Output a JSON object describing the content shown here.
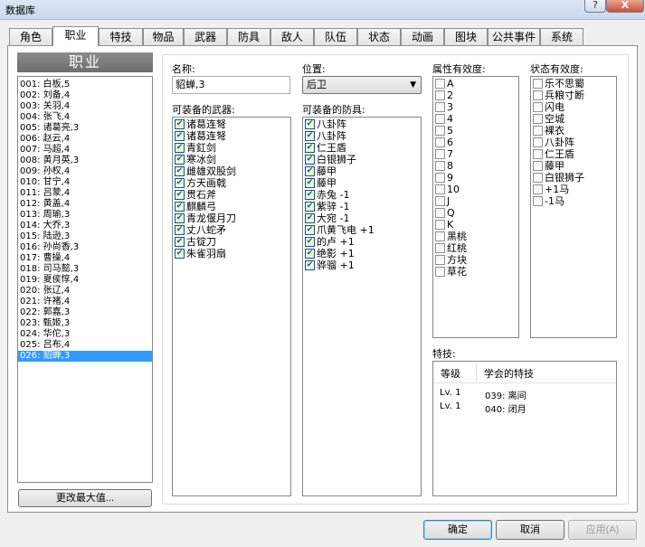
{
  "window": {
    "title": "数据库",
    "help_label": "?",
    "close_label": "X"
  },
  "tabs": [
    "角色",
    "职业",
    "特技",
    "物品",
    "武器",
    "防具",
    "敌人",
    "队伍",
    "状态",
    "动画",
    "图块",
    "公共事件",
    "系统"
  ],
  "active_tab": 1,
  "class_panel": {
    "header": "职业",
    "items": [
      "001: 白板,5",
      "002: 刘备,4",
      "003: 关羽,4",
      "004: 张飞,4",
      "005: 诸葛亮,3",
      "006: 赵云,4",
      "007: 马超,4",
      "008: 黄月英,3",
      "009: 孙权,4",
      "010: 甘宁,4",
      "011: 吕蒙,4",
      "012: 黄盖,4",
      "013: 周瑜,3",
      "014: 大乔,3",
      "015: 陆逊,3",
      "016: 孙尚香,3",
      "017: 曹操,4",
      "018: 司马懿,3",
      "019: 夏侯惇,4",
      "020: 张辽,4",
      "021: 许褚,4",
      "022: 郭嘉,3",
      "023: 甄姬,3",
      "024: 华佗,3",
      "025: 吕布,4",
      "026: 貂蝉,3"
    ],
    "selected_index": 25,
    "change_max_label": "更改最大值..."
  },
  "form": {
    "name_label": "名称:",
    "name_value": "貂蝉,3",
    "position_label": "位置:",
    "position_value": "后卫",
    "weapons_label": "可装备的武器:",
    "weapons": [
      {
        "text": "诸葛连弩",
        "checked": true
      },
      {
        "text": "诸葛连弩",
        "checked": true
      },
      {
        "text": "青釭剑",
        "checked": true
      },
      {
        "text": "寒冰剑",
        "checked": true
      },
      {
        "text": "雌雄双股剑",
        "checked": true
      },
      {
        "text": "方天画戟",
        "checked": true
      },
      {
        "text": "贯石斧",
        "checked": true
      },
      {
        "text": "麒麟弓",
        "checked": true
      },
      {
        "text": "青龙偃月刀",
        "checked": true
      },
      {
        "text": "丈八蛇矛",
        "checked": true
      },
      {
        "text": "古锭刀",
        "checked": true
      },
      {
        "text": "朱雀羽扇",
        "checked": true
      }
    ],
    "armors_label": "可装备的防具:",
    "armors": [
      {
        "text": "八卦阵",
        "checked": true
      },
      {
        "text": "八卦阵",
        "checked": true
      },
      {
        "text": "仁王盾",
        "checked": true
      },
      {
        "text": "白银狮子",
        "checked": true
      },
      {
        "text": "藤甲",
        "checked": true
      },
      {
        "text": "藤甲",
        "checked": true
      },
      {
        "text": "赤兔 -1",
        "checked": true
      },
      {
        "text": "紫骍 -1",
        "checked": true
      },
      {
        "text": "大宛 -1",
        "checked": true
      },
      {
        "text": "爪黄飞电 +1",
        "checked": true
      },
      {
        "text": "的卢 +1",
        "checked": true
      },
      {
        "text": "绝影 +1",
        "checked": true
      },
      {
        "text": "骅骝 +1",
        "checked": true
      }
    ],
    "element_label": "属性有效度:",
    "elements": [
      "A",
      "2",
      "3",
      "4",
      "5",
      "6",
      "7",
      "8",
      "9",
      "10",
      "J",
      "Q",
      "K",
      "黑桃",
      "红桃",
      "方块",
      "草花"
    ],
    "state_label": "状态有效度:",
    "states": [
      "乐不思蜀",
      "兵粮寸断",
      "闪电",
      "空城",
      "裸衣",
      "八卦阵",
      "仁王盾",
      "藤甲",
      "白银狮子",
      "+1马",
      "-1马"
    ],
    "skills_label": "特技:",
    "skills_headers": [
      "等级",
      "学会的特技"
    ],
    "skills": [
      {
        "level": "Lv. 1",
        "skill": "039: 离间"
      },
      {
        "level": "Lv. 1",
        "skill": "040: 闭月"
      }
    ]
  },
  "buttons": {
    "ok": "确定",
    "cancel": "取消",
    "apply": "应用(A)"
  },
  "colors": {
    "selection": "#3399ff",
    "check": "#1e6e1e",
    "header_bg": "#7c7c7c"
  }
}
